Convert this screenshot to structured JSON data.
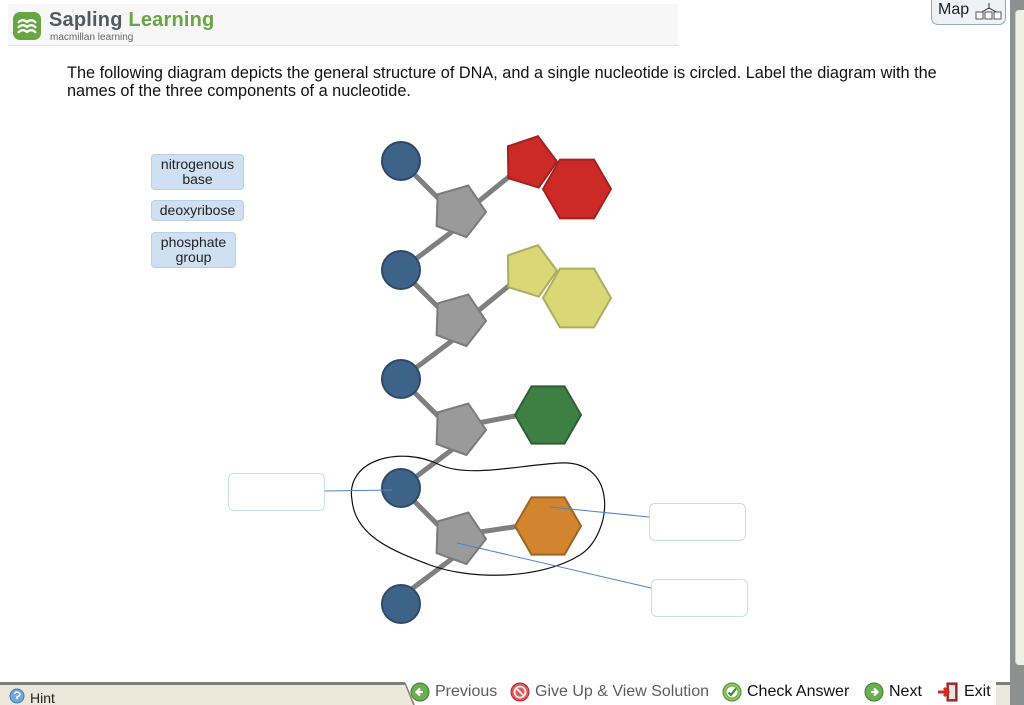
{
  "brand": {
    "name_part1": "Sapling",
    "name_part2": "Learning",
    "subtitle": "macmillan learning",
    "accent_color": "#6aa543"
  },
  "map_button": {
    "label": "Map",
    "icon": "sitemap-icon"
  },
  "question": {
    "text": "The following diagram depicts the general structure of DNA, and a single nucleotide is circled. Label the diagram with the names of the three components of a nucleotide."
  },
  "label_bank": [
    {
      "label": "nitrogenous base"
    },
    {
      "label": "deoxyribose"
    },
    {
      "label": "phosphate group"
    }
  ],
  "diagram": {
    "nucleotides": [
      {
        "phosphate_color": "#3d6389",
        "sugar_color": "#9a9a9a",
        "base_color": "#cc2a27",
        "base_type": "purine"
      },
      {
        "phosphate_color": "#3d6389",
        "sugar_color": "#9a9a9a",
        "base_color": "#d9d776",
        "base_type": "purine"
      },
      {
        "phosphate_color": "#3d6389",
        "sugar_color": "#9a9a9a",
        "base_color": "#3e7f44",
        "base_type": "pyrimidine"
      },
      {
        "phosphate_color": "#3d6389",
        "sugar_color": "#9a9a9a",
        "base_color": "#d2852e",
        "base_type": "pyrimidine",
        "circled": true
      }
    ],
    "drop_targets": [
      {
        "points_to": "phosphate",
        "value": ""
      },
      {
        "points_to": "base",
        "value": ""
      },
      {
        "points_to": "sugar",
        "value": ""
      }
    ]
  },
  "footer": {
    "hint_label": "Hint",
    "nav": [
      {
        "label": "Previous",
        "icon": "arrow-left-icon",
        "enabled": false
      },
      {
        "label": "Give Up & View Solution",
        "icon": "give-up-icon",
        "enabled": false
      },
      {
        "label": "Check Answer",
        "icon": "check-icon",
        "enabled": true
      },
      {
        "label": "Next",
        "icon": "arrow-right-icon",
        "enabled": true
      },
      {
        "label": "Exit",
        "icon": "exit-door-icon",
        "enabled": true
      }
    ]
  }
}
